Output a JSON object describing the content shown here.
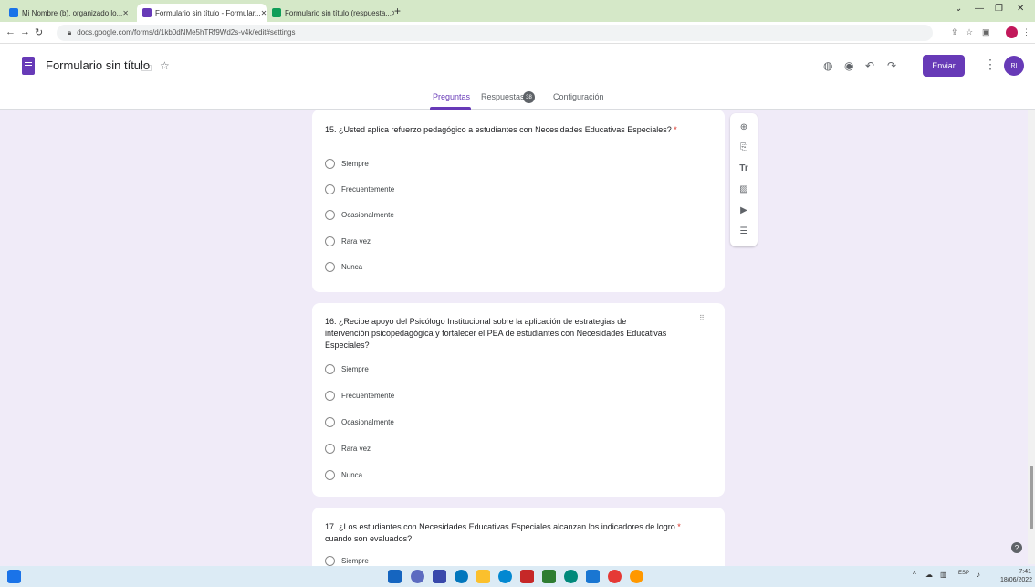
{
  "browser": {
    "tabs": [
      {
        "label": "Mi Nombre (b), organizado lo...",
        "active": false,
        "favicon_color": "#1a73e8"
      },
      {
        "label": "Formulario sin título - Formular...",
        "active": true,
        "favicon_color": "#673ab7"
      },
      {
        "label": "Formulario sin título (respuesta...",
        "active": false,
        "favicon_color": "#0f9d58"
      }
    ],
    "new_tab": "+",
    "url": "docs.google.com/forms/d/1kb0dNMe5hTRf9Wd2s-v4k/edit#settings",
    "window_controls": [
      "⌄",
      "—",
      "❐",
      "✕"
    ]
  },
  "header": {
    "form_title": "Formulario sin título",
    "send_label": "Enviar",
    "avatar_initials": "RI",
    "tabs": {
      "questions": "Preguntas",
      "responses": "Respuestas",
      "responses_count": "38",
      "settings": "Configuración"
    }
  },
  "questions": [
    {
      "number": "15.",
      "text": "¿Usted aplica refuerzo pedagógico a estudiantes con Necesidades Educativas Especiales?",
      "required": true,
      "options": [
        "Siempre",
        "Frecuentemente",
        "Ocasionalmente",
        "Rara vez",
        "Nunca"
      ]
    },
    {
      "number": "16.",
      "text_lines": [
        "¿Recibe apoyo del Psicólogo Institucional sobre la aplicación de estrategias de",
        "intervención psicopedagógica y fortalecer el PEA de estudiantes con Necesidades Educativas",
        "Especiales?"
      ],
      "required": false,
      "options": [
        "Siempre",
        "Frecuentemente",
        "Ocasionalmente",
        "Rara vez",
        "Nunca"
      ]
    },
    {
      "number": "17.",
      "text_lines": [
        "¿Los estudiantes con Necesidades Educativas Especiales alcanzan los indicadores de logro",
        "cuando son evaluados?"
      ],
      "required": true,
      "options": [
        "Siempre"
      ]
    }
  ],
  "required_marker": "*",
  "floating_toolbar": [
    "add-question",
    "import-questions",
    "add-title",
    "add-image",
    "add-video",
    "add-section"
  ],
  "colors": {
    "accent": "#673ab7",
    "page_background": "#f0ebf8",
    "tab_strip": "#d5e8c8"
  }
}
